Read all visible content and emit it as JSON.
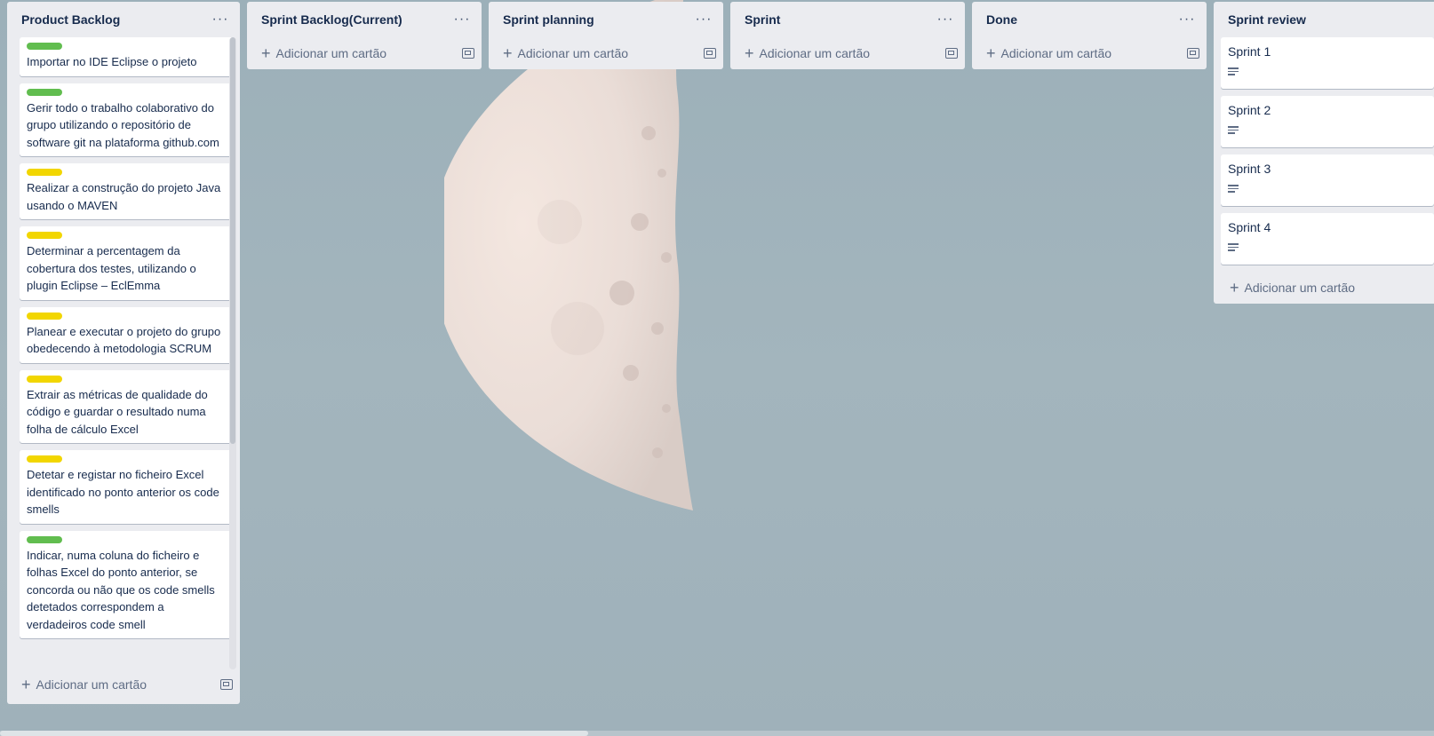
{
  "colors": {
    "green_label": "#61bd4f",
    "yellow_label": "#f2d600",
    "list_bg": "#ebecf0"
  },
  "lists": {
    "product_backlog": {
      "title": "Product Backlog",
      "cards": [
        {
          "label": "green",
          "text": "Importar no IDE Eclipse o projeto"
        },
        {
          "label": "green",
          "text": "Gerir todo o trabalho colaborativo do grupo utilizando o repositório de software git na plataforma github.com"
        },
        {
          "label": "yellow",
          "text": "Realizar a construção do projeto Java usando o MAVEN"
        },
        {
          "label": "yellow",
          "text": "Determinar a percentagem da cobertura dos testes, utilizando o plugin Eclipse – EclEmma"
        },
        {
          "label": "yellow",
          "text": "Planear e executar o projeto do grupo obedecendo à metodologia SCRUM"
        },
        {
          "label": "yellow",
          "text": "Extrair as métricas de qualidade do código e guardar o resultado numa folha de cálculo Excel"
        },
        {
          "label": "yellow",
          "text": "Detetar e registar no ficheiro Excel identificado no ponto anterior os code smells"
        },
        {
          "label": "green",
          "text": "Indicar, numa coluna do ficheiro e folhas Excel do ponto anterior, se concorda ou não que os code smells detetados correspondem a verdadeiros code smell"
        }
      ],
      "add_label": "Adicionar um cartão"
    },
    "sprint_backlog": {
      "title": "Sprint Backlog(Current)",
      "add_label": "Adicionar um cartão"
    },
    "sprint_planning": {
      "title": "Sprint planning",
      "add_label": "Adicionar um cartão"
    },
    "sprint": {
      "title": "Sprint",
      "add_label": "Adicionar um cartão"
    },
    "done": {
      "title": "Done",
      "add_label": "Adicionar um cartão"
    },
    "sprint_review": {
      "title": "Sprint review",
      "cards": [
        "Sprint 1",
        "Sprint 2",
        "Sprint 3",
        "Sprint 4"
      ],
      "add_label": "Adicionar um cartão"
    }
  },
  "icons": {
    "menu": "more-horizontal-icon",
    "plus": "plus-icon",
    "template": "card-template-icon",
    "description": "description-icon"
  }
}
